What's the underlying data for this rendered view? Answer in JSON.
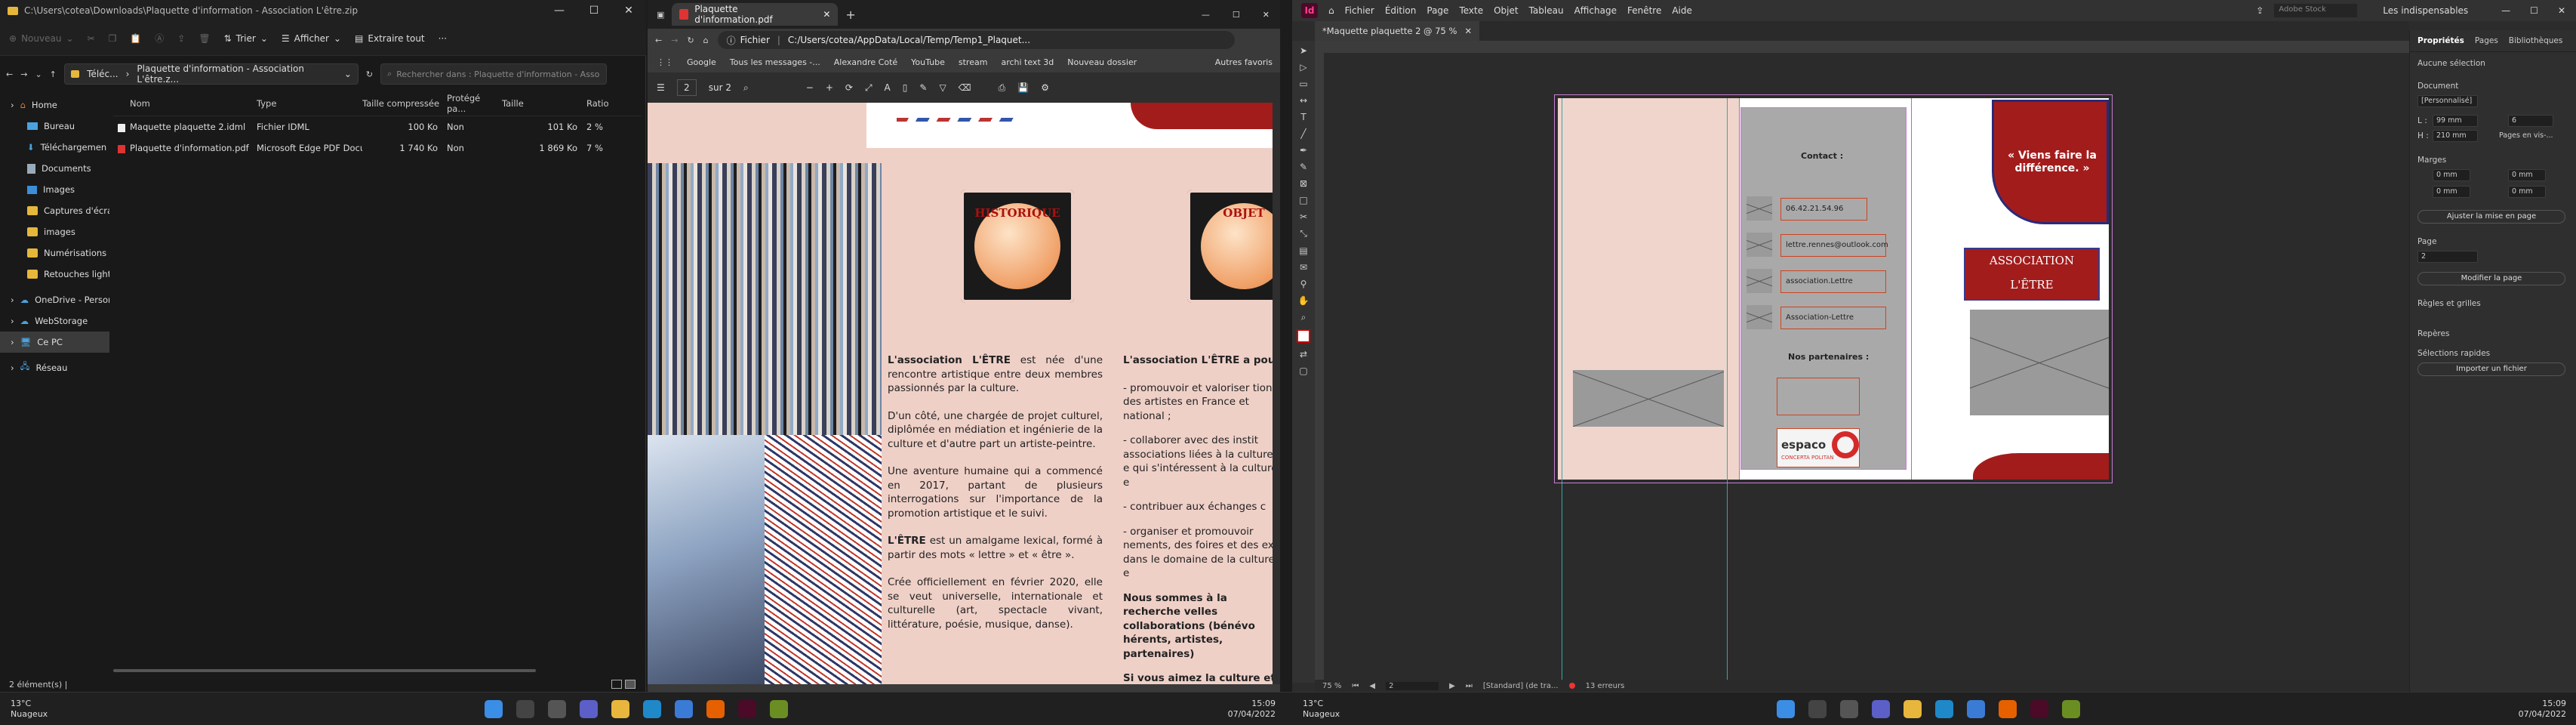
{
  "explorer": {
    "title_path": "C:\\Users\\cotea\\Downloads\\Plaquette d'information - Association L'être.zip",
    "cmd": {
      "new": "Nouveau",
      "sort": "Trier",
      "view": "Afficher",
      "extract": "Extraire tout",
      "more": "···"
    },
    "breadcrumb": [
      "Téléc...",
      "Plaquette d'information - Association L'être.z..."
    ],
    "search_placeholder": "Rechercher dans : Plaquette d'information - Associatio...",
    "nav": [
      {
        "label": "Home",
        "pinned": false
      },
      {
        "label": "Bureau",
        "pinned": true
      },
      {
        "label": "Téléchargemen",
        "pinned": true
      },
      {
        "label": "Documents",
        "pinned": true
      },
      {
        "label": "Images",
        "pinned": true
      },
      {
        "label": "Captures d'écran",
        "pinned": false
      },
      {
        "label": "images",
        "pinned": false
      },
      {
        "label": "Numérisations",
        "pinned": false
      },
      {
        "label": "Retouches lightroo",
        "pinned": false
      },
      {
        "label": "OneDrive - Personal",
        "pinned": false
      },
      {
        "label": "WebStorage",
        "pinned": false
      },
      {
        "label": "Ce PC",
        "pinned": false
      },
      {
        "label": "Réseau",
        "pinned": false
      }
    ],
    "columns": [
      "Nom",
      "Type",
      "Taille compressée",
      "Protégé pa...",
      "Taille",
      "Ratio"
    ],
    "files": [
      {
        "name": "Maquette plaquette 2.idml",
        "type": "Fichier IDML",
        "compressed": "100 Ko",
        "protected": "Non",
        "size": "101 Ko",
        "ratio": "2 %",
        "kind": "idml"
      },
      {
        "name": "Plaquette d'information.pdf",
        "type": "Microsoft Edge PDF Docu...",
        "compressed": "1 740 Ko",
        "protected": "Non",
        "size": "1 869 Ko",
        "ratio": "7 %",
        "kind": "pdf"
      }
    ],
    "status": "2 élément(s)  |"
  },
  "pdf": {
    "tab_title": "Plaquette d'information.pdf",
    "url_label": "Fichier",
    "url": "C:/Users/cotea/AppData/Local/Temp/Temp1_Plaquet...",
    "bookmarks": [
      "Google",
      "Tous les messages -...",
      "Alexandre Coté",
      "YouTube",
      "stream",
      "archi text 3d",
      "Nouveau dossier",
      "Autres favoris"
    ],
    "page_current": "2",
    "page_total": "sur 2",
    "stamp1": "HISTORIQUE",
    "stamp2": "OBJET",
    "col1": [
      {
        "bold": "L'association L'ÊTRE",
        "text": " est née d'une rencontre artistique entre deux membres passionnés par la culture."
      },
      {
        "bold": "",
        "text": "D'un côté, une chargée de projet culturel, diplômée en médiation et ingénierie de la culture et d'autre part un artiste-peintre."
      },
      {
        "bold": "",
        "text": "Une aventure humaine qui a commencé en 2017, partant de plusieurs interrogations sur l'importance de la promotion artistique et le suivi."
      },
      {
        "bold": "L'ÊTRE",
        "text": " est un amalgame lexical, formé à partir des mots « lettre » et « être »."
      },
      {
        "bold": "",
        "text": "Crée officiellement en février 2020, elle se veut universelle, internationale et culturelle (art, spectacle vivant, littérature, poésie, musique, danse)."
      }
    ],
    "col2": {
      "heading": "L'association L'ÊTRE a pour o",
      "items": [
        "promouvoir et valoriser tions des artistes en France et national ;",
        "collaborer avec des instit associations liées à la culture e qui s'intéressent à la culture e",
        "contribuer aux échanges c",
        "organiser et promouvoir nements, des foires et des ex dans le domaine de la culture e"
      ],
      "para1": "Nous sommes à la recherche velles collaborations (bénévo hérents, artistes, partenaires)",
      "para2": "Si vous aimez la culture et c avez des idées à nous faire p nous sommes à votre disposit en discuter."
    }
  },
  "indesign": {
    "menu": [
      "Fichier",
      "Édition",
      "Page",
      "Texte",
      "Objet",
      "Tableau",
      "Affichage",
      "Fenêtre",
      "Aide"
    ],
    "workspace": "Les indispensables",
    "search_placeholder": "Adobe Stock",
    "doc_tab": "*Maquette plaquette 2 @ 75 %",
    "doc": {
      "contact_title": "Contact :",
      "contacts": [
        "06.42.21.54.96",
        "lettre.rennes@outlook.com",
        "association.Lettre",
        "Association-Lettre"
      ],
      "partners_title": "Nos partenaires :",
      "partner_logo": "espaco",
      "partner_logo_sub": "CONCERTA POLITAN",
      "quote": "« Viens faire la différence. »",
      "assoc_line1": "ASSOCIATION",
      "assoc_line2": "L'ÊTRE"
    },
    "status": {
      "zoom": "75 %",
      "page": "2",
      "style": "[Standard] (de tra...",
      "errors": "13 erreurs"
    },
    "panel": {
      "tabs": [
        "Propriétés",
        "Pages",
        "Bibliothèques"
      ],
      "no_selection": "Aucune sélection",
      "document": "Document",
      "preset": "[Personnalisé]",
      "width_label": "L :",
      "width": "99 mm",
      "height_label": "H :",
      "height": "210 mm",
      "pages_count": "6",
      "facing": "Pages en vis-...",
      "margins": "Marges",
      "margin_values": [
        "0 mm",
        "0 mm",
        "0 mm",
        "0 mm"
      ],
      "adjust_btn": "Ajuster la mise en page",
      "page_section": "Page",
      "page_value": "2",
      "edit_page_btn": "Modifier la page",
      "rulers": "Règles et grilles",
      "guides": "Repères",
      "quick_sel": "Sélections rapides",
      "import_btn": "Importer un fichier"
    }
  },
  "taskbar": {
    "temp": "13°C",
    "weather": "Nuageux",
    "time": "15:09",
    "date": "07/04/2022"
  }
}
